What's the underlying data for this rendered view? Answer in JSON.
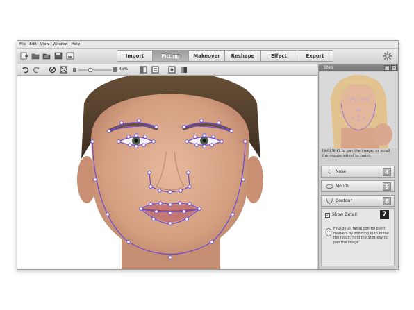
{
  "menu": [
    "File",
    "Edit",
    "View",
    "Window",
    "Help"
  ],
  "tabs": [
    {
      "label": "Import",
      "active": false
    },
    {
      "label": "Fitting",
      "active": true
    },
    {
      "label": "Makeover",
      "active": false
    },
    {
      "label": "Reshape",
      "active": false
    },
    {
      "label": "Effect",
      "active": false
    },
    {
      "label": "Export",
      "active": false
    }
  ],
  "toolbar": {
    "zoom": "45%",
    "icons": [
      "undo-icon",
      "redo-icon",
      "reset-icon",
      "fit-screen-icon",
      "zoom-slider",
      "split-view-icon",
      "compare-view-icon",
      "face-points-icon",
      "contrast-icon"
    ]
  },
  "panel": {
    "title": "Step",
    "hint": "Hold Shift to pan the image, or scroll the mouse wheel to zoom.",
    "steps": [
      {
        "label": "Nose",
        "number": "4"
      },
      {
        "label": "Mouth",
        "number": "5"
      },
      {
        "label": "Contour",
        "number": "6"
      }
    ],
    "show_detail_label": "Show Detail",
    "show_detail_checked": true,
    "current_step": "7",
    "detail_text": "Finalize all facial control point markers by zooming in to refine the result; hold the Shift key to pan the image."
  },
  "colors": {
    "marker_line": "#6a4ad8",
    "marker_point": "#ffffff",
    "active_tab": "#a8a8a8"
  }
}
